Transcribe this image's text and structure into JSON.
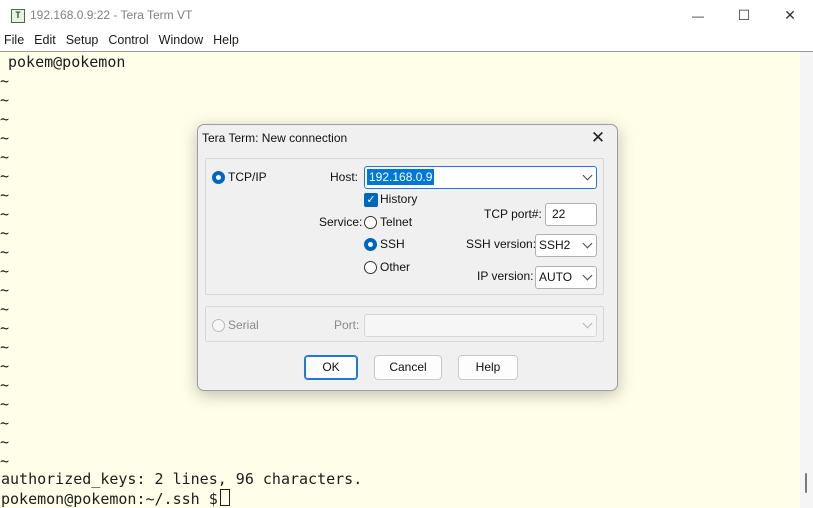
{
  "window": {
    "title": "192.168.0.9:22 - Tera Term VT",
    "app_icon_glyph": "T",
    "controls": {
      "minimize": "—",
      "maximize": "☐",
      "close": "✕"
    }
  },
  "menu": [
    "File",
    "Edit",
    "Setup",
    "Control",
    "Window",
    "Help"
  ],
  "terminal": {
    "first_line": "pokem@pokemon",
    "tilde": "~",
    "tilde_count": 21,
    "status_line": "authorized_keys: 2 lines, 96 characters.",
    "prompt": "pokemon@pokemon:~/.ssh $",
    "background": "#fefee9"
  },
  "dialog": {
    "title": "Tera Term: New connection",
    "close_glyph": "✕",
    "tcpip": {
      "radio_label": "TCP/IP",
      "selected": true,
      "host_label": "Host:",
      "host_value": "192.168.0.9",
      "history_label": "History",
      "history_checked": true,
      "service_label": "Service:",
      "services": [
        {
          "label": "Telnet",
          "checked": false
        },
        {
          "label": "SSH",
          "checked": true
        },
        {
          "label": "Other",
          "checked": false
        }
      ],
      "tcp_port_label": "TCP port#:",
      "tcp_port_value": "22",
      "ssh_version_label": "SSH version:",
      "ssh_version_value": "SSH2",
      "ip_version_label": "IP version:",
      "ip_version_value": "AUTO"
    },
    "serial": {
      "radio_label": "Serial",
      "port_label": "Port:",
      "port_value": ""
    },
    "buttons": {
      "ok": "OK",
      "cancel": "Cancel",
      "help": "Help"
    }
  },
  "colors": {
    "accent": "#0067c0",
    "focus_border": "#1b7ad8",
    "selection": "#0078d7"
  }
}
